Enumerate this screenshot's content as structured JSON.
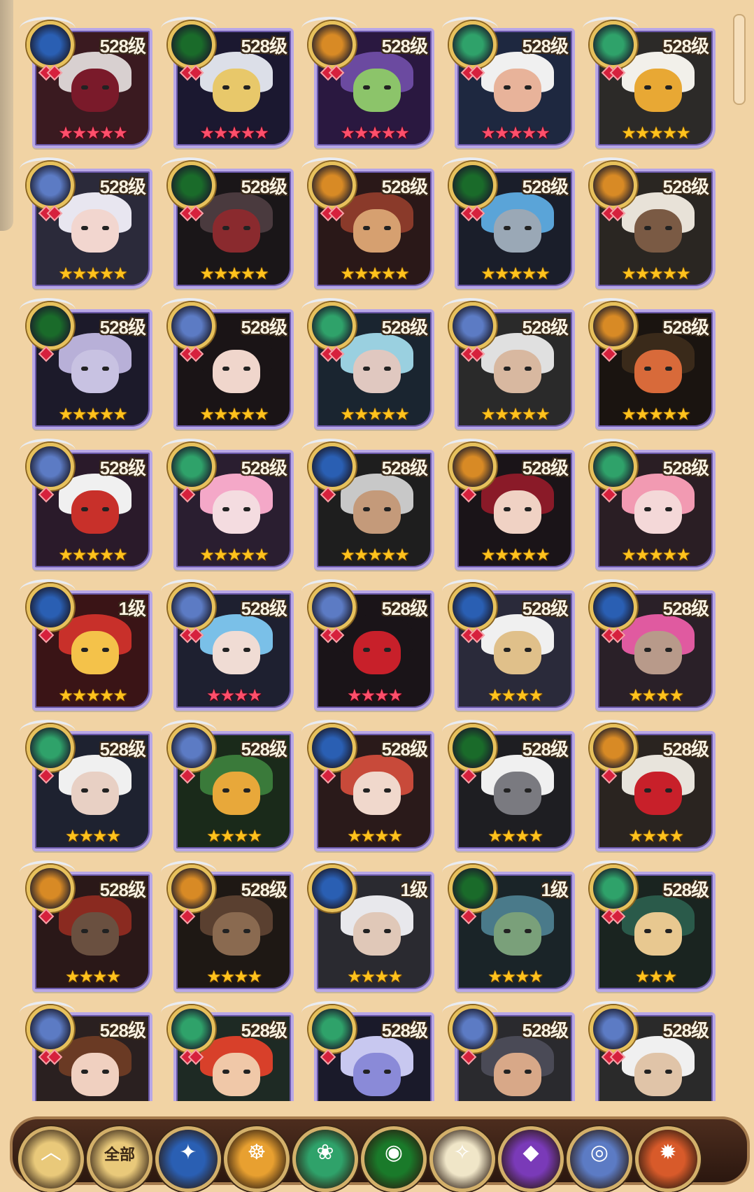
{
  "bottom_bar": {
    "all_label": "全部"
  },
  "heroes": [
    {
      "level": "528级",
      "stars": "★★★★★",
      "star_color": "red",
      "faction": "lightbearer",
      "faction_color": "#2a5fb3",
      "gems": 2,
      "palette": [
        "#3a1a20",
        "#d8d0d0",
        "#7a1a2a"
      ]
    },
    {
      "level": "528级",
      "stars": "★★★★★",
      "star_color": "red",
      "faction": "mauler",
      "faction_color": "#1a6b2a",
      "gems": 2,
      "palette": [
        "#1b1830",
        "#dcdfe8",
        "#e8c86a"
      ]
    },
    {
      "level": "528级",
      "stars": "★★★★★",
      "star_color": "red",
      "faction": "graveborn",
      "faction_color": "#d88a25",
      "gems": 2,
      "palette": [
        "#2a1840",
        "#6b4aa0",
        "#8cc46a"
      ]
    },
    {
      "level": "528级",
      "stars": "★★★★★",
      "star_color": "red",
      "faction": "wilder",
      "faction_color": "#2fa26a",
      "gems": 2,
      "palette": [
        "#1e2840",
        "#f0f0f0",
        "#e8b39a"
      ]
    },
    {
      "level": "528级",
      "stars": "★★★★★",
      "star_color": "gold",
      "faction": "wilder",
      "faction_color": "#2fa26a",
      "gems": 2,
      "palette": [
        "#2c2a28",
        "#f2f0ea",
        "#e8a834"
      ]
    },
    {
      "level": "528级",
      "stars": "★★★★★",
      "star_color": "gold",
      "faction": "celestial",
      "faction_color": "#5c7bc4",
      "gems": 2,
      "palette": [
        "#2b2a3a",
        "#e8e6f0",
        "#f2d6cf"
      ]
    },
    {
      "level": "528级",
      "stars": "★★★★★",
      "star_color": "gold",
      "faction": "mauler",
      "faction_color": "#1a6b2a",
      "gems": 2,
      "palette": [
        "#1a1618",
        "#4a3a3e",
        "#8a2a2e"
      ]
    },
    {
      "level": "528级",
      "stars": "★★★★★",
      "star_color": "gold",
      "faction": "graveborn",
      "faction_color": "#d88a25",
      "gems": 2,
      "palette": [
        "#2a1818",
        "#8a3a2a",
        "#d6a070"
      ]
    },
    {
      "level": "528级",
      "stars": "★★★★★",
      "star_color": "gold",
      "faction": "mauler",
      "faction_color": "#1a6b2a",
      "gems": 2,
      "palette": [
        "#1a1e2a",
        "#5aa4d8",
        "#9aa8b6"
      ]
    },
    {
      "level": "528级",
      "stars": "★★★★★",
      "star_color": "gold",
      "faction": "graveborn",
      "faction_color": "#d88a25",
      "gems": 2,
      "palette": [
        "#2a2622",
        "#e8e2d8",
        "#7a5a44"
      ]
    },
    {
      "level": "528级",
      "stars": "★★★★★",
      "star_color": "gold",
      "faction": "mauler",
      "faction_color": "#1a6b2a",
      "gems": 1,
      "palette": [
        "#1c1a2a",
        "#b8b0d8",
        "#c8c2e2"
      ]
    },
    {
      "level": "528级",
      "stars": "★★★★★",
      "star_color": "gold",
      "faction": "celestial",
      "faction_color": "#5c7bc4",
      "gems": 2,
      "palette": [
        "#1a1416",
        "#1a1416",
        "#f0d6cc"
      ]
    },
    {
      "level": "528级",
      "stars": "★★★★★",
      "star_color": "gold",
      "faction": "wilder",
      "faction_color": "#2fa26a",
      "gems": 2,
      "palette": [
        "#1a2530",
        "#9ad0e0",
        "#e0c8c0"
      ]
    },
    {
      "level": "528级",
      "stars": "★★★★★",
      "star_color": "gold",
      "faction": "celestial",
      "faction_color": "#5c7bc4",
      "gems": 2,
      "palette": [
        "#2a2a2a",
        "#e0e0e0",
        "#d8b8a0"
      ]
    },
    {
      "level": "528级",
      "stars": "★★★★★",
      "star_color": "gold",
      "faction": "graveborn",
      "faction_color": "#d88a25",
      "gems": 1,
      "palette": [
        "#1a1410",
        "#3a2a1a",
        "#d86a3a"
      ]
    },
    {
      "level": "528级",
      "stars": "★★★★★",
      "star_color": "gold",
      "faction": "celestial",
      "faction_color": "#5c7bc4",
      "gems": 1,
      "palette": [
        "#2a1a2a",
        "#f0f0f0",
        "#c8302a"
      ]
    },
    {
      "level": "528级",
      "stars": "★★★★★",
      "star_color": "gold",
      "faction": "wilder",
      "faction_color": "#2fa26a",
      "gems": 1,
      "palette": [
        "#2a1e30",
        "#f4a8c8",
        "#f4dce0"
      ]
    },
    {
      "level": "528级",
      "stars": "★★★★★",
      "star_color": "gold",
      "faction": "lightbearer",
      "faction_color": "#2a5fb3",
      "gems": 1,
      "palette": [
        "#1e1e1e",
        "#c8c8c8",
        "#c49a7a"
      ]
    },
    {
      "level": "528级",
      "stars": "★★★★★",
      "star_color": "gold",
      "faction": "graveborn",
      "faction_color": "#d88a25",
      "gems": 1,
      "palette": [
        "#1a1418",
        "#8a1a28",
        "#f0d2c4"
      ]
    },
    {
      "level": "528级",
      "stars": "★★★★★",
      "star_color": "gold",
      "faction": "wilder",
      "faction_color": "#2fa26a",
      "gems": 1,
      "palette": [
        "#2a1e24",
        "#f29ab2",
        "#f4d8d8"
      ]
    },
    {
      "level": "1级",
      "stars": "★★★★★",
      "star_color": "gold",
      "faction": "lightbearer",
      "faction_color": "#2a5fb3",
      "gems": 1,
      "palette": [
        "#3a1416",
        "#c8302a",
        "#f4c24a"
      ]
    },
    {
      "level": "528级",
      "stars": "★★★★",
      "star_color": "red",
      "faction": "celestial",
      "faction_color": "#5c7bc4",
      "gems": 2,
      "palette": [
        "#1e2030",
        "#7ac0e8",
        "#f0dcd4"
      ]
    },
    {
      "level": "528级",
      "stars": "★★★★",
      "star_color": "red",
      "faction": "celestial",
      "faction_color": "#5c7bc4",
      "gems": 2,
      "palette": [
        "#1a1418",
        "#1a1418",
        "#c8202a"
      ]
    },
    {
      "level": "528级",
      "stars": "★★★★",
      "star_color": "gold",
      "faction": "lightbearer",
      "faction_color": "#2a5fb3",
      "gems": 2,
      "palette": [
        "#2a2a3a",
        "#f0f0f0",
        "#e0c08a"
      ]
    },
    {
      "level": "528级",
      "stars": "★★★★",
      "star_color": "gold",
      "faction": "lightbearer",
      "faction_color": "#2a5fb3",
      "gems": 2,
      "palette": [
        "#2a2028",
        "#e05aa0",
        "#b89a8a"
      ]
    },
    {
      "level": "528级",
      "stars": "★★★★",
      "star_color": "gold",
      "faction": "wilder",
      "faction_color": "#2fa26a",
      "gems": 1,
      "palette": [
        "#1e2230",
        "#f0f0f0",
        "#e8d0c4"
      ]
    },
    {
      "level": "528级",
      "stars": "★★★★",
      "star_color": "gold",
      "faction": "celestial",
      "faction_color": "#5c7bc4",
      "gems": 1,
      "palette": [
        "#1a2a1a",
        "#3a7a3a",
        "#e8a83a"
      ]
    },
    {
      "level": "528级",
      "stars": "★★★★",
      "star_color": "gold",
      "faction": "lightbearer",
      "faction_color": "#2a5fb3",
      "gems": 1,
      "palette": [
        "#2a1a1a",
        "#c84a3a",
        "#f0d8cc"
      ]
    },
    {
      "level": "528级",
      "stars": "★★★★",
      "star_color": "gold",
      "faction": "mauler",
      "faction_color": "#1a6b2a",
      "gems": 1,
      "palette": [
        "#1e1e22",
        "#f0f0f0",
        "#7a7a80"
      ]
    },
    {
      "level": "528级",
      "stars": "★★★★",
      "star_color": "gold",
      "faction": "graveborn",
      "faction_color": "#d88a25",
      "gems": 1,
      "palette": [
        "#2a2420",
        "#e8e4dc",
        "#c8202a"
      ]
    },
    {
      "level": "528级",
      "stars": "★★★★",
      "star_color": "gold",
      "faction": "graveborn",
      "faction_color": "#d88a25",
      "gems": 1,
      "palette": [
        "#2a1818",
        "#8a2a20",
        "#6a5040"
      ]
    },
    {
      "level": "528级",
      "stars": "★★★★",
      "star_color": "gold",
      "faction": "graveborn",
      "faction_color": "#d88a25",
      "gems": 1,
      "palette": [
        "#1e1814",
        "#5a4030",
        "#8a6a50"
      ]
    },
    {
      "level": "1级",
      "stars": "★★★★",
      "star_color": "gold",
      "faction": "lightbearer",
      "faction_color": "#2a5fb3",
      "gems": 0,
      "palette": [
        "#2a2a30",
        "#e8e8ec",
        "#e0c8b8"
      ]
    },
    {
      "level": "1级",
      "stars": "★★★★",
      "star_color": "gold",
      "faction": "mauler",
      "faction_color": "#1a6b2a",
      "gems": 1,
      "palette": [
        "#1a2428",
        "#4a7a8a",
        "#7aa07a"
      ]
    },
    {
      "level": "528级",
      "stars": "★★★",
      "star_color": "gold",
      "faction": "wilder",
      "faction_color": "#2fa26a",
      "gems": 2,
      "palette": [
        "#1a2420",
        "#2a5a4a",
        "#e8c890"
      ]
    },
    {
      "level": "528级",
      "stars": "",
      "star_color": "gold",
      "faction": "celestial",
      "faction_color": "#5c7bc4",
      "gems": 2,
      "palette": [
        "#2a2020",
        "#6a3a24",
        "#f0d0c0"
      ]
    },
    {
      "level": "528级",
      "stars": "",
      "star_color": "gold",
      "faction": "wilder",
      "faction_color": "#2fa26a",
      "gems": 2,
      "palette": [
        "#1e2a24",
        "#d8402a",
        "#f0c8a8"
      ]
    },
    {
      "level": "528级",
      "stars": "",
      "star_color": "gold",
      "faction": "wilder",
      "faction_color": "#2fa26a",
      "gems": 1,
      "palette": [
        "#1a1a2a",
        "#c8c8f0",
        "#8a8ad8"
      ]
    },
    {
      "level": "528级",
      "stars": "",
      "star_color": "gold",
      "faction": "celestial",
      "faction_color": "#5c7bc4",
      "gems": 1,
      "palette": [
        "#2a2a2e",
        "#4a4a56",
        "#d8a888"
      ]
    },
    {
      "level": "528级",
      "stars": "",
      "star_color": "gold",
      "faction": "celestial",
      "faction_color": "#5c7bc4",
      "gems": 2,
      "palette": [
        "#2a2a2a",
        "#f0f0f0",
        "#e0c4a8"
      ]
    }
  ],
  "filters": [
    {
      "name": "collapse-up",
      "glyph": "︿",
      "color": "#e9c97a"
    },
    {
      "name": "all",
      "glyph": "",
      "color": "#e9c97a"
    },
    {
      "name": "lightbearer",
      "glyph": "✦",
      "color": "#2a5fb3"
    },
    {
      "name": "graveborn",
      "glyph": "☸",
      "color": "#e8a030"
    },
    {
      "name": "wilder",
      "glyph": "❀",
      "color": "#2fa26a"
    },
    {
      "name": "mauler",
      "glyph": "◉",
      "color": "#1a7a2a"
    },
    {
      "name": "celestial",
      "glyph": "✧",
      "color": "#f0e6c8"
    },
    {
      "name": "hypogean",
      "glyph": "◆",
      "color": "#7a3ab8"
    },
    {
      "name": "dimensional",
      "glyph": "◎",
      "color": "#5c7bc4"
    },
    {
      "name": "extra",
      "glyph": "✹",
      "color": "#d85a2a"
    }
  ]
}
